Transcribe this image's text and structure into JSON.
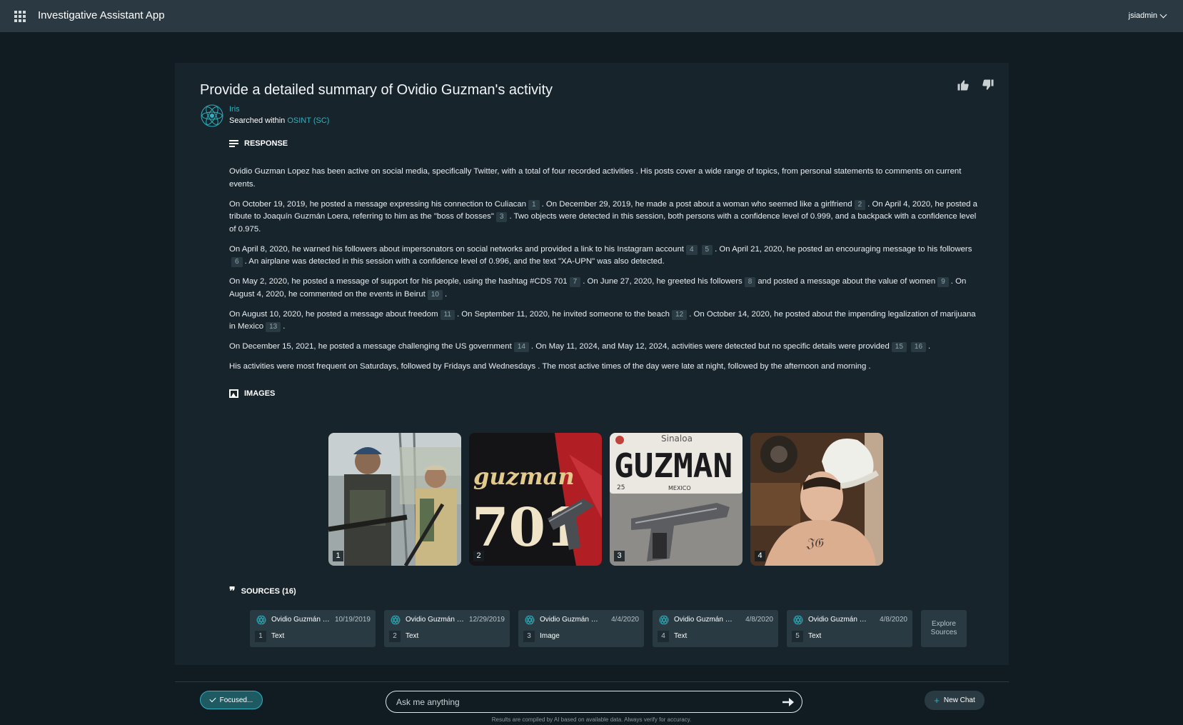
{
  "app": {
    "title": "Investigative Assistant App",
    "user": "jsiadmin"
  },
  "question": "Provide a detailed summary of Ovidio Guzman's activity",
  "assistant": {
    "name": "Iris",
    "searched_prefix": "Searched within",
    "source_name": "OSINT (SC)"
  },
  "response": {
    "heading": "RESPONSE",
    "paragraphs": [
      [
        {
          "t": "Ovidio Guzman Lopez has been active on social media, specifically Twitter, with a total of four recorded activities . His posts cover a wide range of topics, from personal statements to comments on current events."
        }
      ],
      [
        {
          "t": "On October 19, 2019, he posted a message expressing his connection to Culiacan"
        },
        {
          "c": "1"
        },
        {
          "t": ". On December 29, 2019, he made a post about a woman who seemed like a girlfriend"
        },
        {
          "c": "2"
        },
        {
          "t": ". On April 4, 2020, he posted a tribute to Joaquín Guzmán Loera, referring to him as the \"boss of bosses\""
        },
        {
          "c": "3"
        },
        {
          "t": ". Two objects were detected in this session, both persons with a confidence level of 0.999, and a backpack with a confidence level of 0.975."
        }
      ],
      [
        {
          "t": "On April 8, 2020, he warned his followers about impersonators on social networks and provided a link to his Instagram account"
        },
        {
          "c": "4"
        },
        {
          "c": "5"
        },
        {
          "t": ". On April 21, 2020, he posted an encouraging message to his followers"
        },
        {
          "c": "6"
        },
        {
          "t": ". An airplane was detected in this session with a confidence level of 0.996, and the text \"XA-UPN\" was also detected."
        }
      ],
      [
        {
          "t": "On May 2, 2020, he posted a message of support for his people, using the hashtag #CDS 701"
        },
        {
          "c": "7"
        },
        {
          "t": ". On June 27, 2020, he greeted his followers"
        },
        {
          "c": "8"
        },
        {
          "t": "and posted a message about the value of women"
        },
        {
          "c": "9"
        },
        {
          "t": ". On August 4, 2020, he commented on the events in Beirut"
        },
        {
          "c": "10"
        },
        {
          "t": "."
        }
      ],
      [
        {
          "t": "On August 10, 2020, he posted a message about freedom"
        },
        {
          "c": "11"
        },
        {
          "t": ". On September 11, 2020, he invited someone to the beach"
        },
        {
          "c": "12"
        },
        {
          "t": ". On October 14, 2020, he posted about the impending legalization of marijuana in Mexico"
        },
        {
          "c": "13"
        },
        {
          "t": "."
        }
      ],
      [
        {
          "t": "On December 15, 2021, he posted a message challenging the US government"
        },
        {
          "c": "14"
        },
        {
          "t": ". On May 11, 2024, and May 12, 2024, activities were detected but no specific details were provided"
        },
        {
          "c": "15"
        },
        {
          "c": "16"
        },
        {
          "t": "."
        }
      ],
      [
        {
          "t": "His activities were most frequent on Saturdays, followed by Fridays and Wednesdays . The most active times of the day were late at night, followed by the afternoon and morning ."
        }
      ]
    ]
  },
  "images": {
    "heading": "IMAGES",
    "items": [
      {
        "num": "1",
        "name": "image-two-men-with-rifles"
      },
      {
        "num": "2",
        "name": "image-guzman-701-shirt-pistol",
        "shirt_text": "guzman",
        "shirt_number": "701"
      },
      {
        "num": "3",
        "name": "image-sinaloa-plate-pistol",
        "plate_state": "Sinaloa",
        "plate_text": "GUZMAN",
        "plate_num": "25",
        "plate_country": "MEXICO"
      },
      {
        "num": "4",
        "name": "image-man-cowboy-hat"
      }
    ]
  },
  "sources": {
    "heading": "SOURCES (16)",
    "items": [
      {
        "title": "Ovidio Guzmán López",
        "date": "10/19/2019",
        "idx": "1",
        "type": "Text"
      },
      {
        "title": "Ovidio Guzmán López",
        "date": "12/29/2019",
        "idx": "2",
        "type": "Text"
      },
      {
        "title": "Ovidio Guzmán López",
        "date": "4/4/2020",
        "idx": "3",
        "type": "Image"
      },
      {
        "title": "Ovidio Guzmán López",
        "date": "4/8/2020",
        "idx": "4",
        "type": "Text"
      },
      {
        "title": "Ovidio Guzmán López",
        "date": "4/8/2020",
        "idx": "5",
        "type": "Text"
      }
    ],
    "explore_label": "Explore Sources"
  },
  "composer": {
    "focused_label": "Focused...",
    "placeholder": "Ask me anything",
    "new_chat_label": "New Chat",
    "disclaimer": "Results are compiled by AI based on available data. Always verify for accuracy."
  },
  "colors": {
    "accent": "#2bb3c0",
    "topbar": "#2b3a42",
    "background": "#111b22",
    "card": "#18242c"
  }
}
